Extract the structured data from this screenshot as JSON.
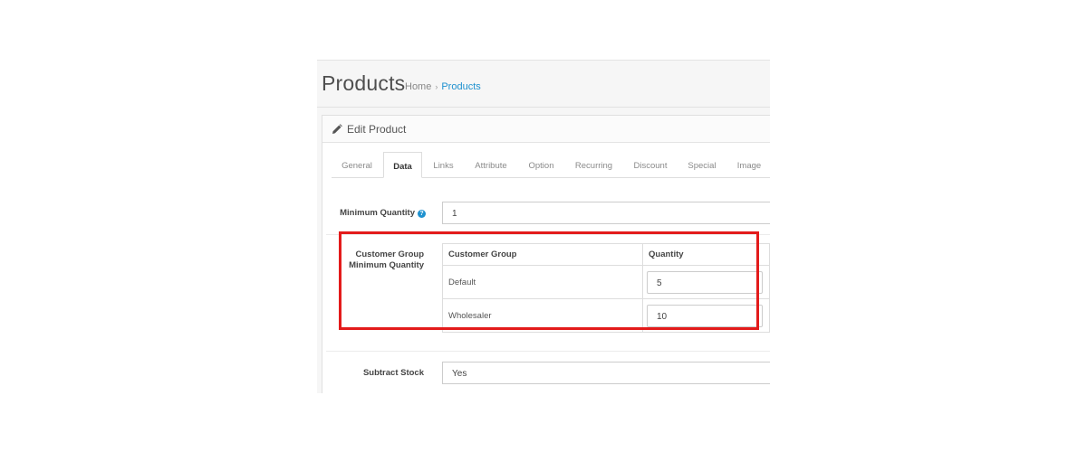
{
  "page": {
    "title": "Products",
    "breadcrumb": {
      "home": "Home",
      "separator": "›",
      "current": "Products"
    }
  },
  "panel": {
    "title": "Edit Product"
  },
  "tabs": [
    {
      "label": "General",
      "active": false
    },
    {
      "label": "Data",
      "active": true
    },
    {
      "label": "Links",
      "active": false
    },
    {
      "label": "Attribute",
      "active": false
    },
    {
      "label": "Option",
      "active": false
    },
    {
      "label": "Recurring",
      "active": false
    },
    {
      "label": "Discount",
      "active": false
    },
    {
      "label": "Special",
      "active": false
    },
    {
      "label": "Image",
      "active": false
    }
  ],
  "form": {
    "minimum_quantity": {
      "label": "Minimum Quantity",
      "help_icon": "?",
      "value": "1"
    },
    "customer_group_min": {
      "label_line1": "Customer Group",
      "label_line2": "Minimum Quantity",
      "columns": [
        "Customer Group",
        "Quantity"
      ],
      "rows": [
        {
          "group": "Default",
          "quantity": "5"
        },
        {
          "group": "Wholesaler",
          "quantity": "10"
        }
      ]
    },
    "subtract_stock": {
      "label": "Subtract Stock",
      "value": "Yes"
    }
  },
  "colors": {
    "link": "#1e91cf",
    "highlight_border": "#e31b1b",
    "help_badge": "#1e91cf"
  }
}
